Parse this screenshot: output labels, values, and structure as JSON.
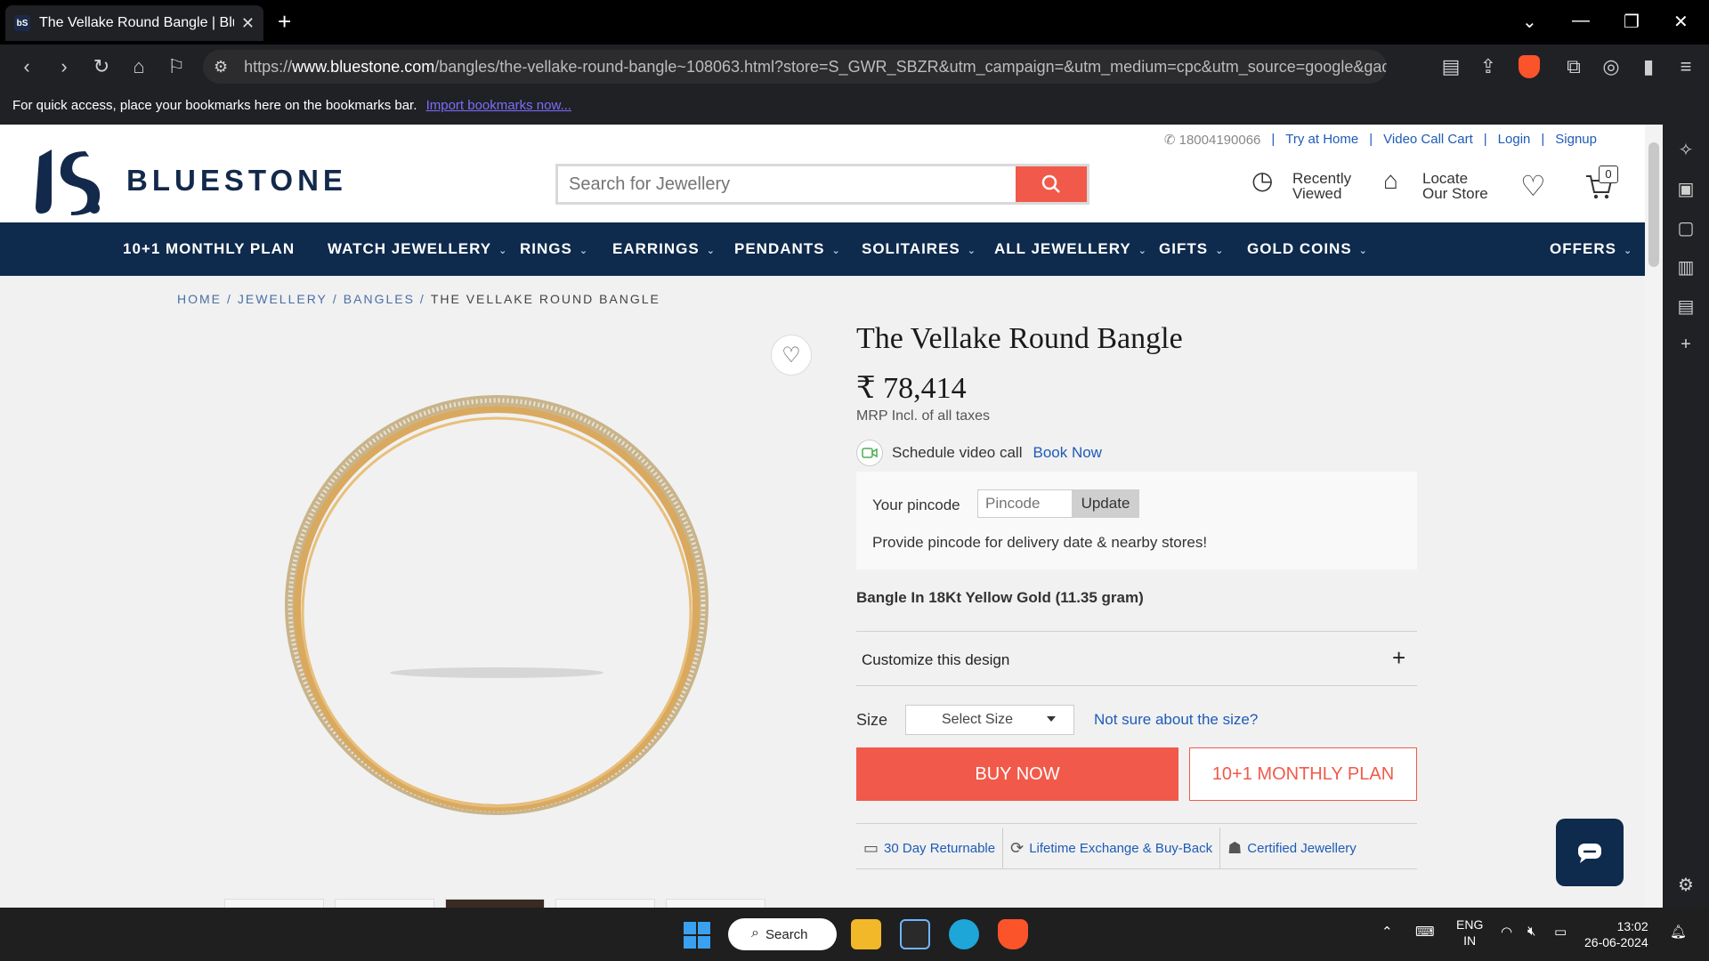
{
  "browser": {
    "tab_title": "The Vellake Round Bangle | Blue",
    "url_prefix": "https://",
    "url_domain": "www.bluestone.com",
    "url_path": "/bangles/the-vellake-round-bangle~108063.html?store=S_GWR_SBZR&utm_campaign=&utm_medium=cpc&utm_source=google&gad_source...",
    "bookmarks_text": "For quick access, place your bookmarks here on the bookmarks bar.",
    "bookmarks_link": "Import bookmarks now..."
  },
  "header": {
    "brand": "BLUESTONE",
    "phone": "18004190066",
    "links": [
      "Try at Home",
      "Video Call Cart",
      "Login",
      "Signup"
    ],
    "search_placeholder": "Search for Jewellery",
    "recently_line1": "Recently",
    "recently_line2": "Viewed",
    "locate_line1": "Locate",
    "locate_line2": "Our Store",
    "cart_count": "0"
  },
  "nav": {
    "items": [
      "10+1 MONTHLY PLAN",
      "WATCH JEWELLERY",
      "RINGS",
      "EARRINGS",
      "PENDANTS",
      "SOLITAIRES",
      "ALL JEWELLERY",
      "GIFTS",
      "GOLD COINS",
      "OFFERS"
    ]
  },
  "breadcrumb": {
    "home": "HOME",
    "jewellery": "JEWELLERY",
    "bangles": "BANGLES",
    "current": "THE VELLAKE ROUND BANGLE"
  },
  "product": {
    "title": "The Vellake Round Bangle",
    "price": "₹ 78,414",
    "mrp_note": "MRP Incl. of all taxes",
    "video_call_text": "Schedule video call",
    "video_call_link": "Book Now",
    "pincode_label": "Your pincode",
    "pincode_placeholder": "Pincode",
    "pincode_button": "Update",
    "pincode_message": "Provide pincode for delivery date & nearby stores!",
    "spec": "Bangle In 18Kt Yellow Gold (11.35 gram)",
    "customize_label": "Customize this design",
    "size_label": "Size",
    "size_select": "Select Size",
    "size_help": "Not sure about the size?",
    "buy_now": "BUY NOW",
    "monthly_plan": "10+1 MONTHLY PLAN",
    "features": [
      "30 Day Returnable",
      "Lifetime Exchange & Buy-Back",
      "Certified Jewellery"
    ]
  },
  "taskbar": {
    "search_label": "Search",
    "lang_line1": "ENG",
    "lang_line2": "IN",
    "time": "13:02",
    "date": "26-06-2024"
  },
  "colors": {
    "brand_navy": "#0e2a4c",
    "accent_red": "#f15a4a",
    "link_blue": "#1e5bb8",
    "gold": "#d9a960"
  }
}
